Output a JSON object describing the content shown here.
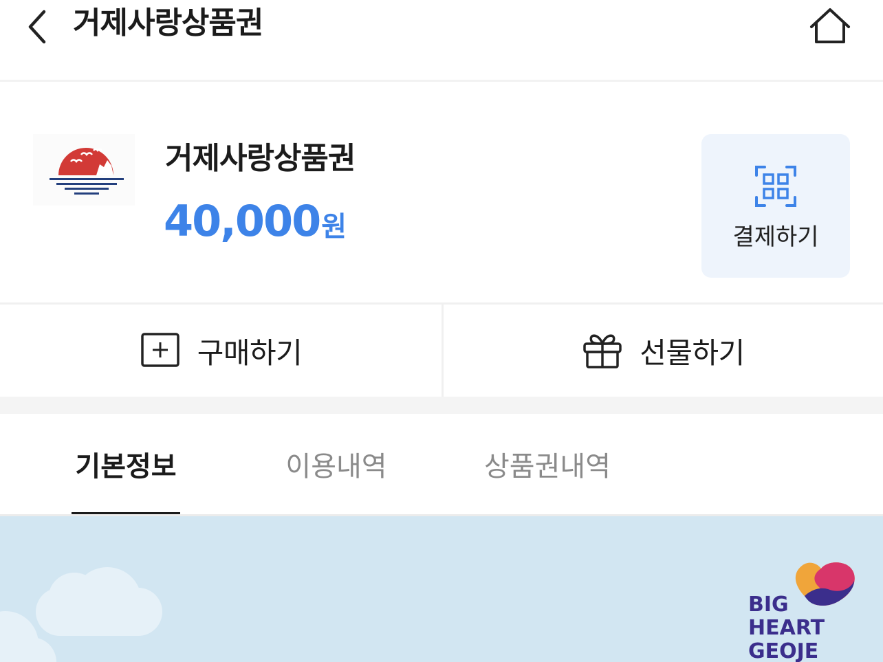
{
  "header": {
    "title": "거제사랑상품권"
  },
  "card": {
    "name": "거제사랑상품권",
    "balance_amount": "40,000",
    "balance_unit": "원",
    "pay_label": "결제하기"
  },
  "actions": {
    "buy_label": "구매하기",
    "gift_label": "선물하기"
  },
  "tabs": [
    {
      "label": "기본정보",
      "active": true
    },
    {
      "label": "이용내역",
      "active": false
    },
    {
      "label": "상품권내역",
      "active": false
    }
  ],
  "banner": {
    "brand_text": [
      "BIG",
      "HEART",
      "GEOJE"
    ]
  },
  "colors": {
    "accent_blue": "#3d83e8",
    "pay_button_bg": "#eef4fc",
    "logo_red": "#d23a36",
    "logo_navy": "#233f7d",
    "brand_purple": "#3b2e8c",
    "banner_bg": "#d2e6f2"
  },
  "icons": [
    "chevron-left-icon",
    "home-icon",
    "qr-scan-icon",
    "plus-square-icon",
    "gift-icon"
  ]
}
